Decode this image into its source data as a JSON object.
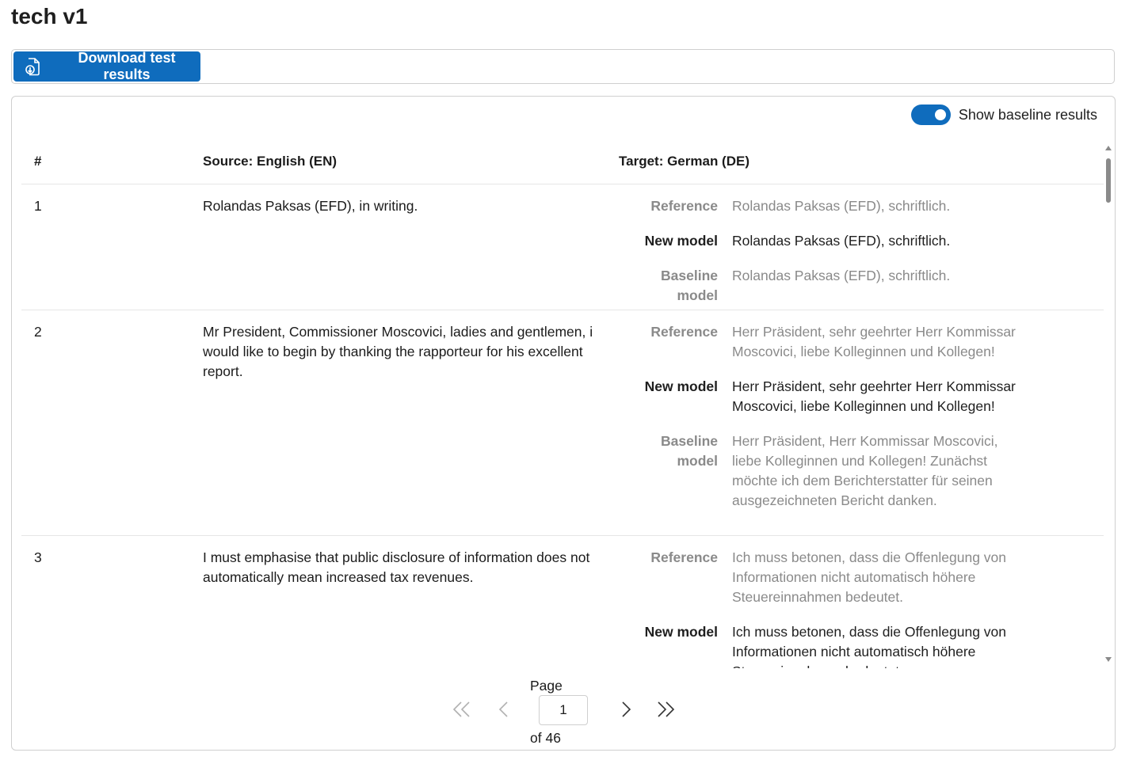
{
  "page": {
    "title": "tech v1"
  },
  "toolbar": {
    "download_label": "Download test results"
  },
  "toggle": {
    "label": "Show baseline results",
    "on": true
  },
  "table": {
    "headers": {
      "num": "#",
      "source": "Source: English (EN)",
      "target": "Target: German (DE)"
    },
    "labels": {
      "reference": "Reference",
      "new_model": "New model",
      "baseline_model": "Baseline model"
    },
    "rows": [
      {
        "num": "1",
        "source": "Rolandas Paksas (EFD), in writing.",
        "reference": "Rolandas Paksas (EFD), schriftlich.",
        "new_model": "Rolandas Paksas (EFD), schriftlich.",
        "baseline_model": "Rolandas Paksas (EFD), schriftlich."
      },
      {
        "num": "2",
        "source": "Mr President, Commissioner Moscovici, ladies and gentlemen, i would like to begin by thanking the rapporteur for his excellent report.",
        "reference": "Herr Präsident, sehr geehrter Herr Kommissar Moscovici, liebe Kolleginnen und Kollegen!",
        "new_model": "Herr Präsident, sehr geehrter Herr Kommissar Moscovici, liebe Kolleginnen und Kollegen!",
        "baseline_model": "Herr Präsident, Herr Kommissar Moscovici, liebe Kolleginnen und Kollegen! Zunächst möchte ich dem Berichterstatter für seinen ausgezeichneten Bericht danken."
      },
      {
        "num": "3",
        "source": "I must emphasise that public disclosure of information does not automatically mean increased tax revenues.",
        "reference": "Ich muss betonen, dass die Offenlegung von Informationen nicht automatisch höhere Steuereinnahmen bedeutet.",
        "new_model": "Ich muss betonen, dass die Offenlegung von Informationen nicht automatisch höhere Steuereinnahmen bedeutet."
      }
    ]
  },
  "pager": {
    "page_label": "Page",
    "current": "1",
    "of_label": "of 46"
  },
  "colors": {
    "accent": "#0f6cbd",
    "muted_text": "#8a8a8a",
    "border": "#cfcfcf"
  },
  "icons": [
    "document-download-icon",
    "first-page-icon",
    "prev-page-icon",
    "next-page-icon",
    "last-page-icon"
  ]
}
